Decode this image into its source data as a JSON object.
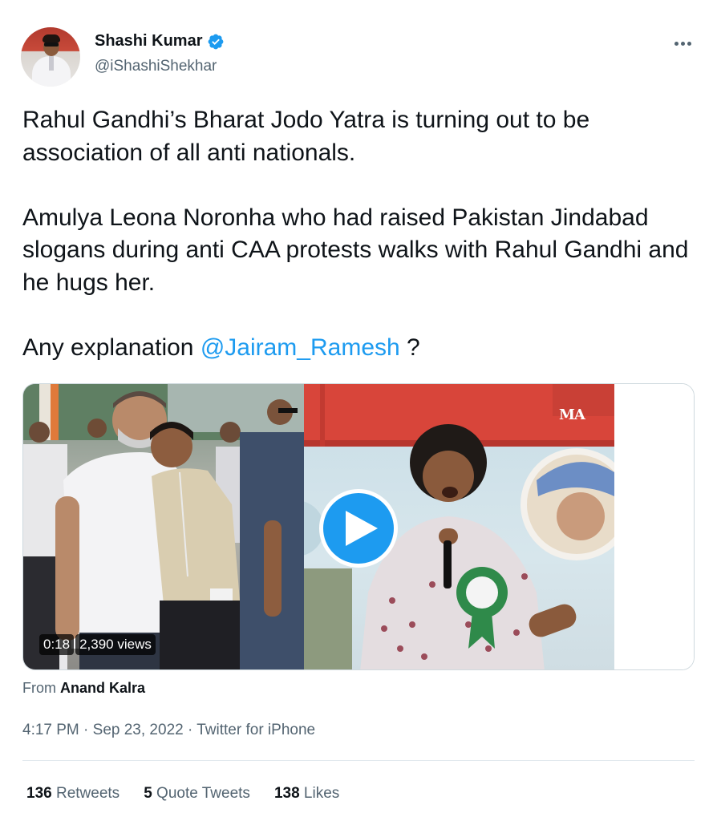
{
  "author": {
    "display_name": "Shashi Kumar",
    "handle": "@iShashiShekhar",
    "verified": true
  },
  "tweet": {
    "paragraphs": [
      "Rahul Gandhi’s Bharat Jodo Yatra is turning out to be association of all anti nationals.",
      "Amulya Leona Noronha who had raised Pakistan Jindabad slogans during anti CAA protests walks with Rahul Gandhi and he hugs her."
    ],
    "last_line_prefix": "Any explanation ",
    "mention": "@Jairam_Ramesh",
    "last_line_suffix": " ?"
  },
  "media": {
    "duration": "0:18",
    "views": "2,390 views",
    "watermark": "MA"
  },
  "attribution": {
    "prefix": "From ",
    "source": "Anand Kalra"
  },
  "meta": {
    "time": "4:17 PM",
    "separator": " · ",
    "date": "Sep 23, 2022",
    "client": "Twitter for iPhone"
  },
  "stats": {
    "retweets_count": "136",
    "retweets_label": " Retweets",
    "quotes_count": "5",
    "quotes_label": " Quote Tweets",
    "likes_count": "138",
    "likes_label": " Likes"
  },
  "colors": {
    "accent": "#1d9bf0",
    "text_primary": "#0f1419",
    "text_secondary": "#536471",
    "border": "#cfd9de"
  },
  "icons": [
    "verified-badge-icon",
    "more-options-icon",
    "play-icon"
  ]
}
